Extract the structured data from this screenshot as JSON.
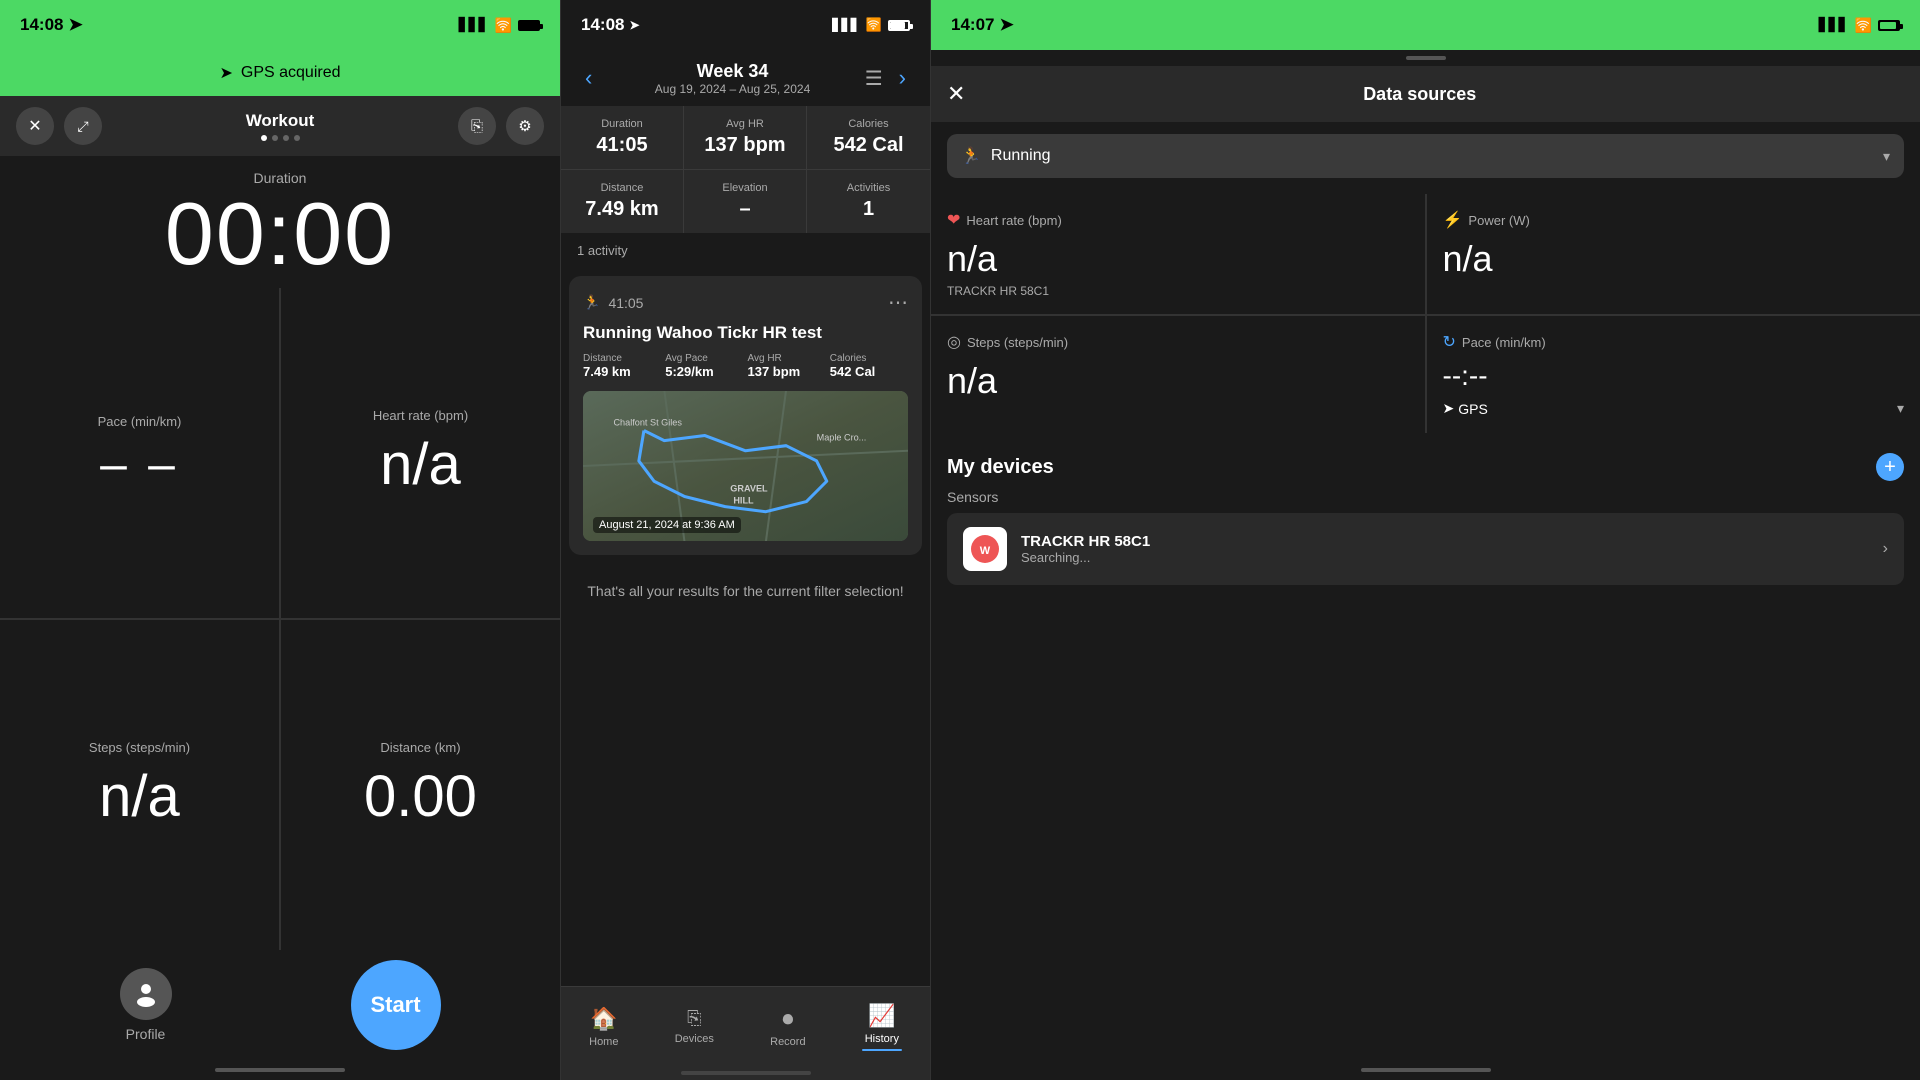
{
  "panel1": {
    "status_time": "14:08",
    "gps_text": "GPS acquired",
    "workout_title": "Workout",
    "duration_label": "Duration",
    "duration_value": "00:00",
    "pace_label": "Pace (min/km)",
    "pace_value": "– –",
    "heartrate_label": "Heart rate (bpm)",
    "heartrate_value": "n/a",
    "steps_label": "Steps (steps/min)",
    "steps_value": "n/a",
    "distance_label": "Distance (km)",
    "distance_value": "0.00",
    "start_label": "Start",
    "profile_label": "Profile"
  },
  "panel2": {
    "status_time": "14:08",
    "week_title": "Week 34",
    "week_dates": "Aug 19, 2024 – Aug 25, 2024",
    "duration_label": "Duration",
    "duration_value": "41:05",
    "avg_hr_label": "Avg HR",
    "avg_hr_value": "137 bpm",
    "calories_label": "Calories",
    "calories_value": "542 Cal",
    "distance_label": "Distance",
    "distance_value": "7.49 km",
    "elevation_label": "Elevation",
    "elevation_value": "–",
    "activities_label": "Activities",
    "activities_value": "1",
    "activity_count": "1 activity",
    "activity_sport": "41:05",
    "activity_title": "Running Wahoo Tickr HR test",
    "act_distance_label": "Distance",
    "act_distance_value": "7.49 km",
    "act_pace_label": "Avg Pace",
    "act_pace_value": "5:29/km",
    "act_hr_label": "Avg HR",
    "act_hr_value": "137 bpm",
    "act_calories_label": "Calories",
    "act_calories_value": "542 Cal",
    "map_timestamp": "August 21, 2024 at 9:36 AM",
    "no_more": "That's all your results for the current filter selection!",
    "nav_home": "Home",
    "nav_devices": "Devices",
    "nav_record": "Record",
    "nav_history": "History"
  },
  "panel3": {
    "status_time": "14:07",
    "title": "Data sources",
    "running_label": "Running",
    "hr_metric": "Heart rate (bpm)",
    "hr_value": "n/a",
    "hr_source": "TRACKR HR 58C1",
    "power_metric": "Power (W)",
    "power_value": "n/a",
    "steps_metric": "Steps (steps/min)",
    "steps_value": "n/a",
    "pace_metric": "Pace (min/km)",
    "pace_value": "--:--",
    "gps_source": "GPS",
    "my_devices_title": "My devices",
    "sensors_label": "Sensors",
    "device_name": "TRACKR HR 58C1",
    "device_status": "Searching..."
  }
}
